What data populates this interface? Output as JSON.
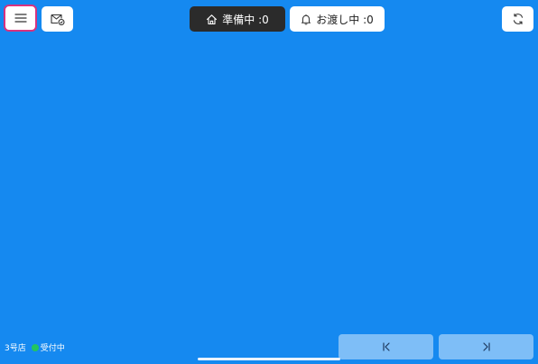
{
  "app": {
    "background_color": "#1589f0",
    "accent_border_color": "#d8327f"
  },
  "toolbar": {
    "menu_button_icon": "hamburger-menu-icon",
    "mail_button_icon": "mail-settings-icon",
    "refresh_button_icon": "refresh-icon",
    "preparing": {
      "icon": "home-icon",
      "label": "準備中 :0"
    },
    "handing_over": {
      "icon": "bell-icon",
      "label": "お渡し中 :0"
    }
  },
  "footer": {
    "store_name": "3号店",
    "status_label": "受付中",
    "status_color": "#22c55e",
    "first_page_icon": "skip-to-first-icon",
    "last_page_icon": "skip-to-last-icon"
  }
}
